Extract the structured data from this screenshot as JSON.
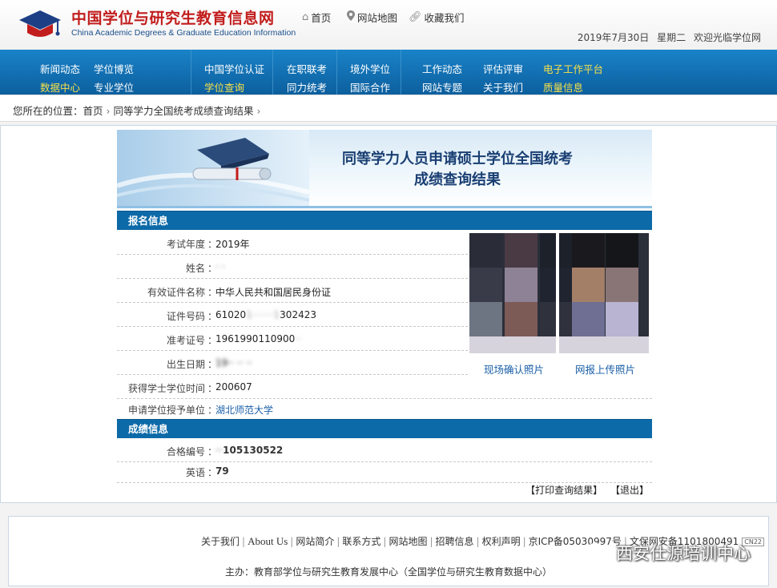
{
  "header": {
    "site_name_cn": "中国学位与研究生教育信息网",
    "site_name_en": "China Academic Degrees & Graduate Education Information",
    "links": [
      {
        "label": "首页",
        "icon": "home-icon"
      },
      {
        "label": "网站地图",
        "icon": "location-pin-icon"
      },
      {
        "label": "收藏我们",
        "icon": "link-icon"
      }
    ],
    "date": "2019年7月30日",
    "weekday": "星期二",
    "welcome": "欢迎光临学位网"
  },
  "nav": {
    "items": [
      {
        "label": "新闻动态"
      },
      {
        "label": "学位博览"
      },
      {
        "label": "数据中心"
      },
      {
        "label": "专业学位"
      },
      {
        "label": "中国学位认证"
      },
      {
        "label": "学位查询"
      },
      {
        "label": "在职联考"
      },
      {
        "label": "同力统考"
      },
      {
        "label": "境外学位"
      },
      {
        "label": "国际合作"
      },
      {
        "label": "工作动态"
      },
      {
        "label": "网站专题"
      },
      {
        "label": "评估评审"
      },
      {
        "label": "关于我们"
      },
      {
        "label": "电子工作平台"
      },
      {
        "label": "质量信息"
      }
    ],
    "highlight_color": "#f7e04a"
  },
  "breadcrumb": {
    "prefix": "您所在的位置：",
    "home": "首页",
    "current": "同等学力全国统考成绩查询结果"
  },
  "banner": {
    "title_line1": "同等学力人员申请硕士学位全国统考",
    "title_line2": "成绩查询结果"
  },
  "registration": {
    "section_title": "报名信息",
    "rows": [
      {
        "key": "考试年度",
        "value": "2019年"
      },
      {
        "key": "姓名",
        "value": "·  ·"
      },
      {
        "key": "有效证件名称",
        "value": "中华人民共和国居民身份证"
      },
      {
        "key": "证件号码",
        "value_visible": "61020",
        "value_blur": "1·······1",
        "value_tail": "302423"
      },
      {
        "key": "准考证号",
        "value_visible": "1961990110900",
        "value_blur": "··"
      },
      {
        "key": "出生日期",
        "value_blur": "19·· ·· ··"
      },
      {
        "key": "获得学士学位时间",
        "value": "200607"
      },
      {
        "key": "申请学位授予单位",
        "value": "湖北师范大学"
      }
    ],
    "photo_labels": [
      "现场确认照片",
      "网报上传照片"
    ]
  },
  "score": {
    "section_title": "成绩信息",
    "rows": [
      {
        "key": "合格编号",
        "value_blur": "··",
        "value_tail": "105130522"
      },
      {
        "key": "英语",
        "value": "79"
      }
    ]
  },
  "actions": {
    "print": "【打印查询结果】",
    "exit": "【退出】"
  },
  "footer": {
    "links": [
      "关于我们",
      "About Us",
      "网站简介",
      "联系方式",
      "网站地图",
      "招聘信息",
      "权利声明",
      "京ICP备05030997号",
      "文保网安备1101800491"
    ],
    "badge": "CN22",
    "host": "主办：教育部学位与研究生教育发展中心（全国学位与研究生教育数据中心）",
    "watermark": "西安仕源培训中心"
  },
  "colors": {
    "nav_blue": "#0d6aa8",
    "logo_red": "#c21d1d",
    "link_blue": "#1a5fa8"
  }
}
